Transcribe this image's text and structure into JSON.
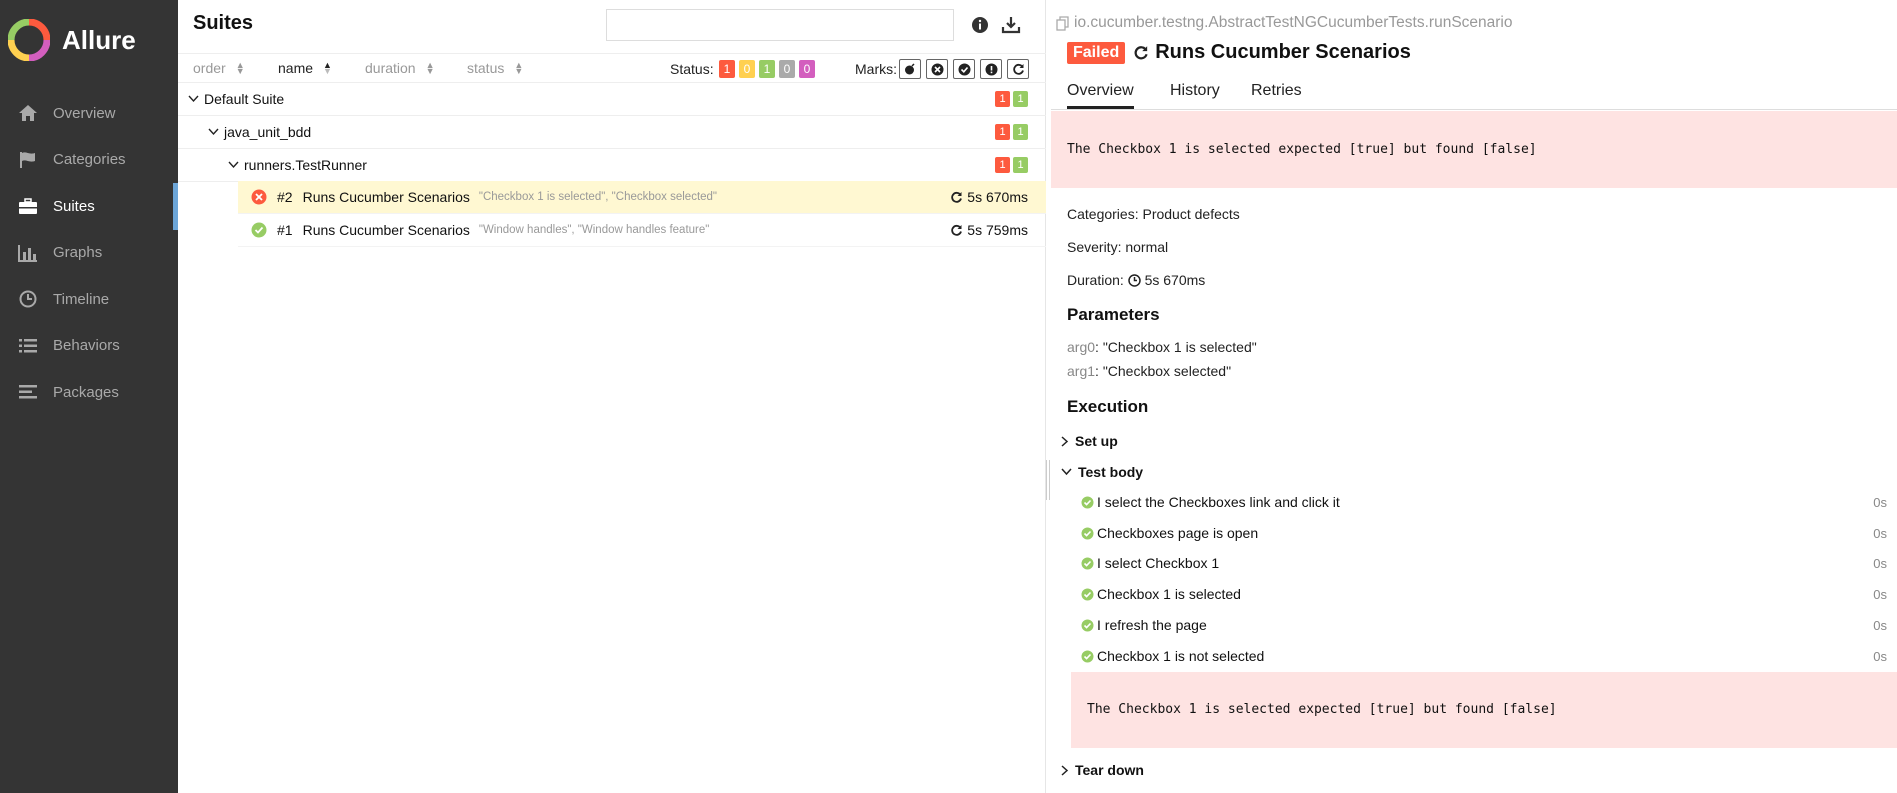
{
  "sidebar": {
    "brand": "Allure",
    "items": [
      {
        "label": "Overview",
        "icon": "home-icon"
      },
      {
        "label": "Categories",
        "icon": "flag-icon"
      },
      {
        "label": "Suites",
        "icon": "briefcase-icon",
        "active": true
      },
      {
        "label": "Graphs",
        "icon": "bar-chart-icon"
      },
      {
        "label": "Timeline",
        "icon": "clock-icon"
      },
      {
        "label": "Behaviors",
        "icon": "list-icon"
      },
      {
        "label": "Packages",
        "icon": "align-left-icon"
      }
    ]
  },
  "suites": {
    "title": "Suites",
    "search_value": "",
    "sort": {
      "order": "order",
      "name": "name",
      "duration": "duration",
      "status": "status"
    },
    "status_label": "Status:",
    "status_counts": [
      "1",
      "0",
      "1",
      "0",
      "0"
    ],
    "marks_label": "Marks:",
    "tree": [
      {
        "label": "Default Suite",
        "failed": "1",
        "passed": "1"
      },
      {
        "label": "java_unit_bdd",
        "failed": "1",
        "passed": "1"
      },
      {
        "label": "runners.TestRunner",
        "failed": "1",
        "passed": "1"
      }
    ],
    "tests": [
      {
        "num": "#2",
        "name": "Runs Cucumber Scenarios",
        "params": "\"Checkbox 1 is selected\", \"Checkbox selected\"",
        "duration": "5s 670ms",
        "status": "failed"
      },
      {
        "num": "#1",
        "name": "Runs Cucumber Scenarios",
        "params": "\"Window handles\", \"Window handles feature\"",
        "duration": "5s 759ms",
        "status": "passed"
      }
    ]
  },
  "detail": {
    "fullname": "io.cucumber.testng.AbstractTestNGCucumberTests.runScenario",
    "status": "Failed",
    "title": "Runs Cucumber Scenarios",
    "tabs": [
      "Overview",
      "History",
      "Retries"
    ],
    "error": "The Checkbox 1 is selected expected [true] but found [false]",
    "categories_label": "Categories:",
    "categories": "Product defects",
    "severity_label": "Severity:",
    "severity": "normal",
    "duration_label": "Duration:",
    "duration": "5s 670ms",
    "parameters_heading": "Parameters",
    "params": [
      {
        "key": "arg0",
        "value": "\"Checkbox 1 is selected\""
      },
      {
        "key": "arg1",
        "value": "\"Checkbox selected\""
      }
    ],
    "execution_heading": "Execution",
    "setup_label": "Set up",
    "body_label": "Test body",
    "steps": [
      {
        "text": "I select the Checkboxes link and click it",
        "dur": "0s"
      },
      {
        "text": "Checkboxes page is open",
        "dur": "0s"
      },
      {
        "text": "I select Checkbox 1",
        "dur": "0s"
      },
      {
        "text": "Checkbox 1 is selected",
        "dur": "0s"
      },
      {
        "text": "I refresh the page",
        "dur": "0s"
      },
      {
        "text": "Checkbox 1 is not selected",
        "dur": "0s"
      }
    ],
    "step_error": "The Checkbox 1 is selected expected [true] but found [false]",
    "teardown_label": "Tear down"
  },
  "colors": {
    "failed": "#fd5a3e",
    "broken": "#ffd050",
    "passed": "#97cc64",
    "skipped": "#aaaaaa",
    "unknown": "#d35ebe",
    "sidebar_bg": "#343434",
    "selected_row": "#fff8d2",
    "error_bg": "#fee3e2"
  }
}
